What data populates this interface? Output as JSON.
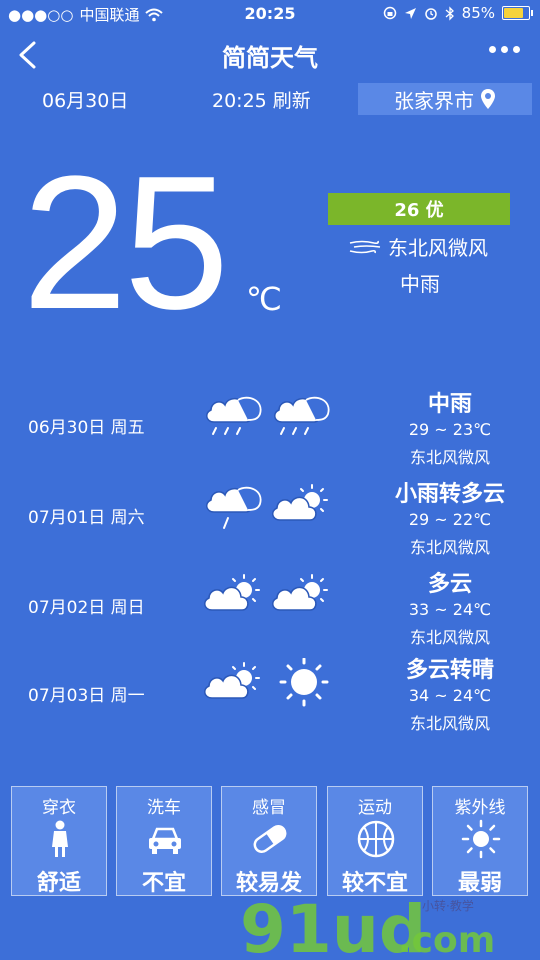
{
  "status_bar": {
    "carrier": "中国联通",
    "time": "20:25",
    "battery": "85%",
    "battery_level": 0.85
  },
  "nav": {
    "title": "简简天气"
  },
  "header": {
    "date": "06月30日",
    "refresh": "20:25 刷新",
    "city": "张家界市"
  },
  "current": {
    "temp": "25",
    "unit": "℃",
    "aqi": "26 优",
    "wind": "东北风微风",
    "condition": "中雨"
  },
  "forecast": [
    {
      "date": "06月30日 周五",
      "condition": "中雨",
      "temp": "29 ~ 23℃",
      "wind": "东北风微风",
      "day_icon": "rain-cloud-icon",
      "night_icon": "rain-cloud-icon"
    },
    {
      "date": "07月01日 周六",
      "condition": "小雨转多云",
      "temp": "29 ~ 22℃",
      "wind": "东北风微风",
      "day_icon": "light-rain-icon",
      "night_icon": "partly-cloudy-icon"
    },
    {
      "date": "07月02日 周日",
      "condition": "多云",
      "temp": "33 ~ 24℃",
      "wind": "东北风微风",
      "day_icon": "partly-cloudy-icon",
      "night_icon": "partly-cloudy-icon"
    },
    {
      "date": "07月03日 周一",
      "condition": "多云转晴",
      "temp": "34 ~ 24℃",
      "wind": "东北风微风",
      "day_icon": "partly-cloudy-icon",
      "night_icon": "sun-icon"
    }
  ],
  "life_index": [
    {
      "title": "穿衣",
      "value": "舒适",
      "icon": "dress-icon"
    },
    {
      "title": "洗车",
      "value": "不宜",
      "icon": "car-icon"
    },
    {
      "title": "感冒",
      "value": "较易发",
      "icon": "pill-icon"
    },
    {
      "title": "运动",
      "value": "较不宜",
      "icon": "basketball-icon"
    },
    {
      "title": "紫外线",
      "value": "最弱",
      "icon": "sun-icon"
    }
  ],
  "watermark": {
    "brand": "91ud.com",
    "tagline": "小转·教学"
  },
  "colors": {
    "background": "#3d6fd8",
    "tile_bg": "#5a88e6",
    "aqi_good": "#7bb62a",
    "battery_fill": "#f6d33b"
  }
}
